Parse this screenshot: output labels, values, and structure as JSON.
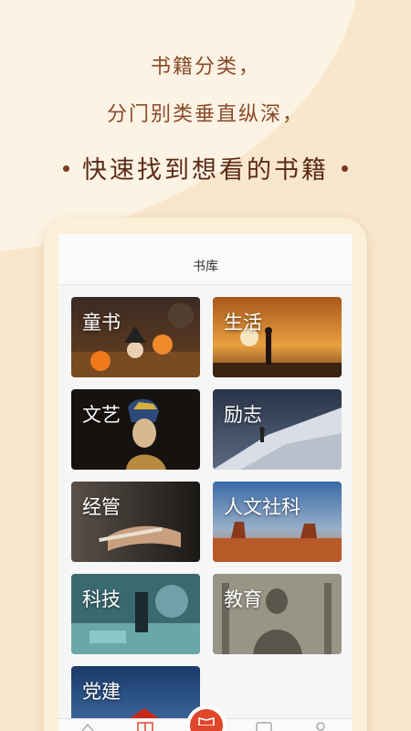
{
  "promo": {
    "line1": "书籍分类，",
    "line2": "分门别类垂直纵深，",
    "line3": "快速找到想看的书籍"
  },
  "app": {
    "title": "书库",
    "categories": [
      {
        "label": "童书"
      },
      {
        "label": "生活"
      },
      {
        "label": "文艺"
      },
      {
        "label": "励志"
      },
      {
        "label": "经管"
      },
      {
        "label": "人文社科"
      },
      {
        "label": "科技"
      },
      {
        "label": "教育"
      },
      {
        "label": "党建"
      }
    ],
    "tabbar": {
      "icons": [
        "home-icon",
        "library-icon",
        "center-action-icon",
        "message-icon",
        "profile-icon"
      ],
      "active_color": "#e0462a"
    }
  },
  "colors": {
    "background": "#f9e7cd",
    "accent_text": "#8a4b2a",
    "fab": "#e0462a"
  }
}
